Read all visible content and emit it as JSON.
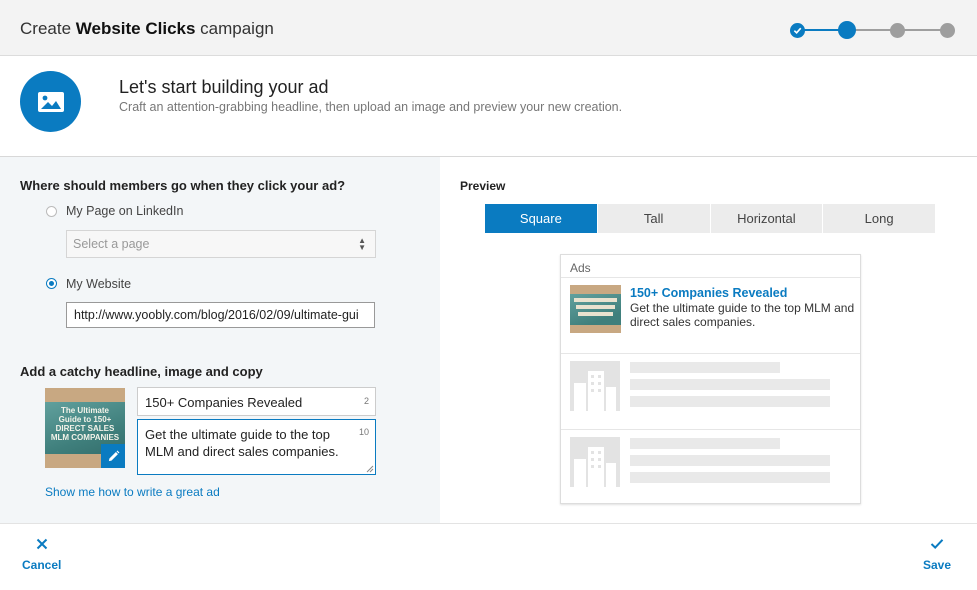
{
  "header": {
    "title_prefix": "Create ",
    "title_bold": "Website Clicks",
    "title_suffix": " campaign",
    "steps": [
      "done",
      "active",
      "todo",
      "todo"
    ]
  },
  "intro": {
    "icon": "image-icon",
    "heading": "Let's start building your ad",
    "subheading": "Craft an attention-grabbing headline, then upload an image and preview your new creation."
  },
  "destination": {
    "question": "Where should members go when they click your ad?",
    "option_page": "My Page on LinkedIn",
    "page_select_placeholder": "Select a page",
    "option_website": "My Website",
    "selected": "My Website",
    "website_url": "http://www.yoobly.com/blog/2016/02/09/ultimate-gui"
  },
  "creative": {
    "section_title": "Add a catchy headline, image and copy",
    "image_text": "The Ultimate Guide to 150+ DIRECT SALES MLM COMPANIES",
    "headline": "150+ Companies Revealed",
    "headline_count": "2",
    "copy": "Get the ultimate guide to the top MLM and direct sales companies.",
    "copy_count": "10",
    "help_link": "Show me how to write a great ad"
  },
  "preview": {
    "label": "Preview",
    "tabs": [
      "Square",
      "Tall",
      "Horizontal",
      "Long"
    ],
    "active_tab": "Square",
    "ads_label": "Ads",
    "ad_title": "150+ Companies Revealed",
    "ad_body": "Get the ultimate guide to the top MLM and direct sales companies."
  },
  "footer": {
    "cancel_label": "Cancel",
    "save_label": "Save"
  },
  "colors": {
    "accent": "#0a7bc1",
    "inactive_step": "#9e9e9e",
    "panel_bg": "#f3f6f8"
  }
}
